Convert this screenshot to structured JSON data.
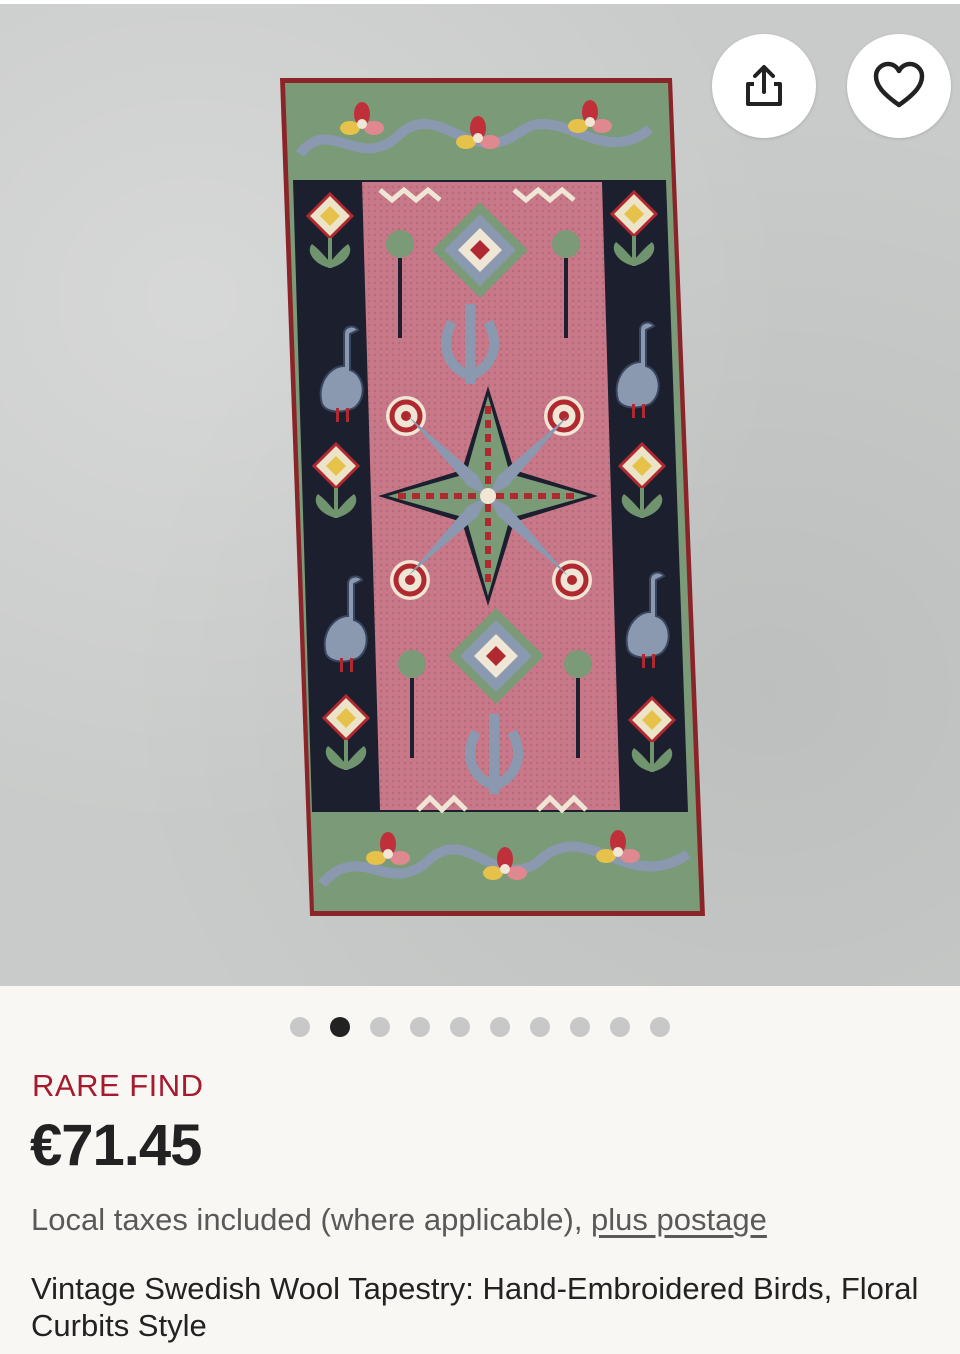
{
  "photo": {
    "description_icon": "tapestry-image",
    "colors": {
      "background": "#c9cbca",
      "pink": "#c87888",
      "navy": "#1c1f2e",
      "green": "#7a9a78",
      "red": "#b02830"
    }
  },
  "actions": {
    "share_icon": "share-icon",
    "favorite_icon": "heart-icon"
  },
  "carousel": {
    "total": 10,
    "active_index": 2
  },
  "listing": {
    "badge": "RARE FIND",
    "price": "€71.45",
    "taxes_text": "Local taxes included (where applicable), ",
    "postage_link": "plus postage",
    "title": "Vintage Swedish Wool Tapestry: Hand-Embroidered Birds, Floral Curbits Style"
  },
  "accent_colors": {
    "badge": "#a61a2e",
    "text": "#222222",
    "muted": "#595959"
  }
}
